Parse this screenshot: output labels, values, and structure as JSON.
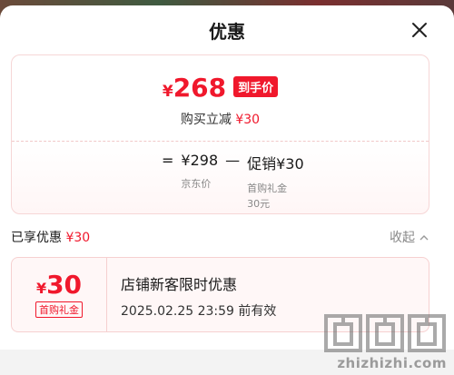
{
  "sheet": {
    "title": "优惠",
    "close_icon": "close-icon"
  },
  "price": {
    "currency": "¥",
    "final": "268",
    "badge": "到手价",
    "discount_label": "购买立减",
    "discount_amount": "¥30"
  },
  "formula": {
    "equals": "=",
    "base_price": "¥298",
    "base_caption": "京东价",
    "minus": "—",
    "promo": "促销¥30",
    "promo_caption": "首购礼金",
    "promo_sub": "30元"
  },
  "enjoyed": {
    "label": "已享优惠",
    "amount": "¥30",
    "collapse_label": "收起",
    "collapse_icon": "chevron-up-icon"
  },
  "coupon": {
    "currency": "¥",
    "amount": "30",
    "tag": "首购礼金",
    "title": "店铺新客限时优惠",
    "expire": "2025.02.25 23:59 前有效"
  },
  "watermark": {
    "text": "zhizhizhi.com"
  },
  "colors": {
    "accent": "#f0182c",
    "card_border": "#f6d6d6",
    "coupon_bg": "#fff7f7"
  }
}
